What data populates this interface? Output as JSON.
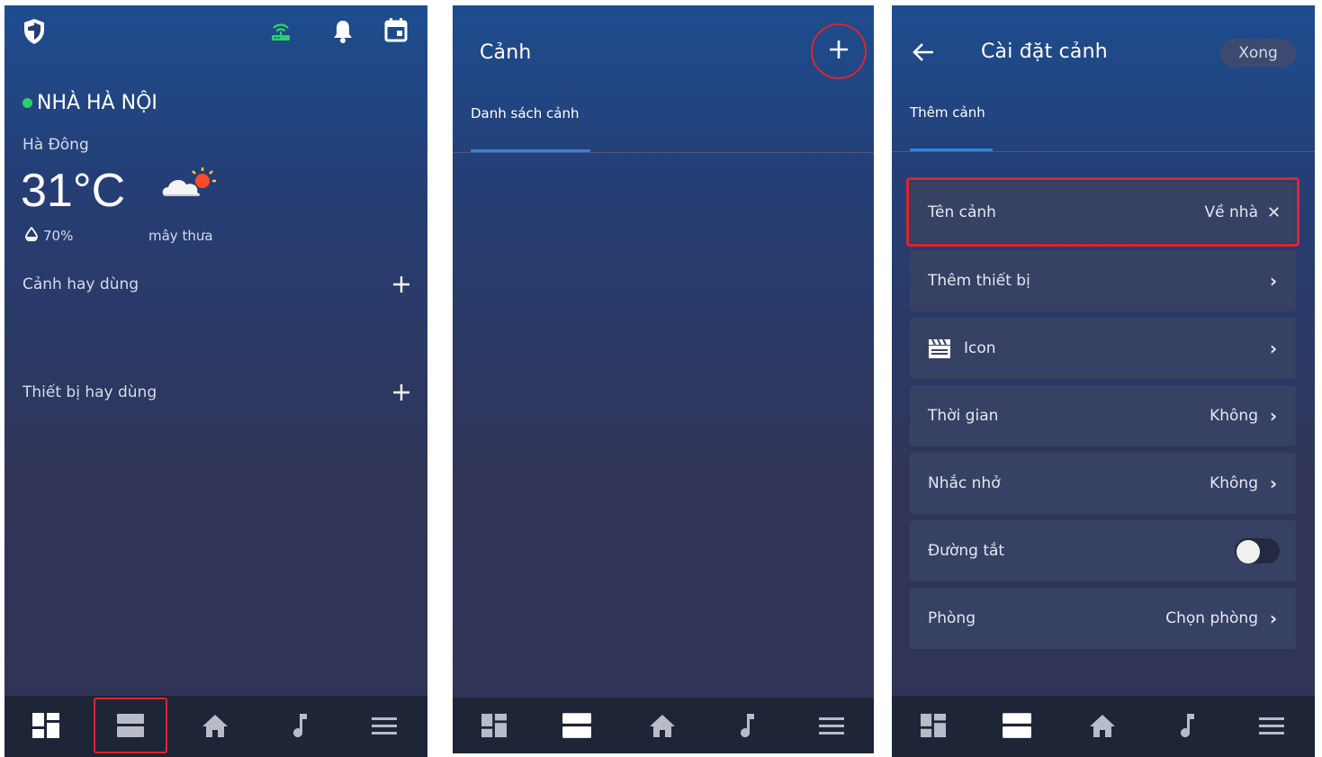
{
  "screen1": {
    "home_name": "NHÀ HÀ NỘI",
    "status_color": "#2bd267",
    "location": "Hà Đông",
    "temperature": "31°C",
    "humidity": "70%",
    "weather_desc": "mây thưa",
    "favorite_scenes_label": "Cảnh hay dùng",
    "favorite_devices_label": "Thiết bị hay dùng",
    "icons": [
      "shield-icon",
      "router-wifi-icon",
      "bell-icon",
      "calendar-icon",
      "cloud-sun-icon",
      "droplet-icon",
      "plus-icon"
    ]
  },
  "screen2": {
    "title": "Cảnh",
    "tab_label": "Danh sách cảnh"
  },
  "screen3": {
    "title": "Cài đặt cảnh",
    "done_label": "Xong",
    "tab_label": "Thêm cảnh",
    "rows": [
      {
        "label": "Tên cảnh",
        "value": "Về nhà"
      },
      {
        "label": "Thêm thiết bị",
        "value": ""
      },
      {
        "label": "Icon",
        "value": ""
      },
      {
        "label": "Thời gian",
        "value": "Không"
      },
      {
        "label": "Nhắc nhở",
        "value": "Không"
      },
      {
        "label": "Đường tắt",
        "value": ""
      },
      {
        "label": "Phòng",
        "value": "Chọn phòng"
      }
    ],
    "shortcut_enabled": false
  },
  "bottom_nav": {
    "items": [
      "dashboard-icon",
      "scenes-icon",
      "home-icon",
      "music-icon",
      "menu-icon"
    ]
  },
  "colors": {
    "highlight": "#e0242c",
    "accent": "#2f86e0",
    "router_green": "#2bd267"
  }
}
